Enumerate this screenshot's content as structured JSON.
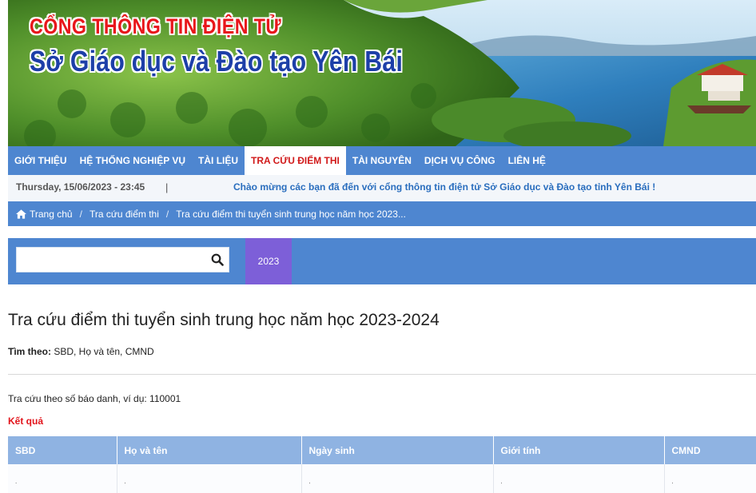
{
  "banner": {
    "title_line1": "CỔNG THÔNG TIN ĐIỆN TỬ",
    "title_line2": "Sở Giáo dục và Đào tạo Yên Bái"
  },
  "nav": {
    "items": [
      {
        "label": "GIỚI THIỆU",
        "active": false
      },
      {
        "label": "HỆ THỐNG NGHIỆP VỤ",
        "active": false
      },
      {
        "label": "TÀI LIỆU",
        "active": false
      },
      {
        "label": "TRA CỨU ĐIỂM THI",
        "active": true
      },
      {
        "label": "TÀI NGUYÊN",
        "active": false
      },
      {
        "label": "DỊCH VỤ CÔNG",
        "active": false
      },
      {
        "label": "LIÊN HỆ",
        "active": false
      }
    ]
  },
  "infobar": {
    "datetime": "Thursday, 15/06/2023 - 23:45",
    "separator": "|",
    "welcome": "Chào mừng các bạn đã đến với cổng thông tin điện tử Sở Giáo dục và Đào tạo tỉnh Yên Bái !"
  },
  "breadcrumb": {
    "items": [
      "Trang chủ",
      "Tra cứu điểm thi",
      "Tra cứu điểm thi tuyển sinh trung học năm học 2023..."
    ],
    "separator": "/"
  },
  "search": {
    "value": "",
    "placeholder": "",
    "icon": "search-icon",
    "year_tab": "2023"
  },
  "content": {
    "title": "Tra cứu điểm thi tuyển sinh trung học năm học 2023-2024",
    "find_by_label": "Tìm theo:",
    "find_by_value": " SBD, Họ và tên, CMND",
    "hint": "Tra cứu theo số báo danh, ví dụ: 110001",
    "result_label": "Kết quả"
  },
  "table": {
    "headers": [
      "SBD",
      "Họ và tên",
      "Ngày sinh",
      "Giới tính",
      "CMND"
    ],
    "rows": [
      [
        ".",
        ".",
        ".",
        ".",
        "."
      ]
    ]
  },
  "colors": {
    "nav_bg": "#4e86d0",
    "active_text": "#d11a1a",
    "year_tab_bg": "#7d5fd8",
    "table_header_bg": "#8fb3e2",
    "result_label": "#e2141b"
  }
}
